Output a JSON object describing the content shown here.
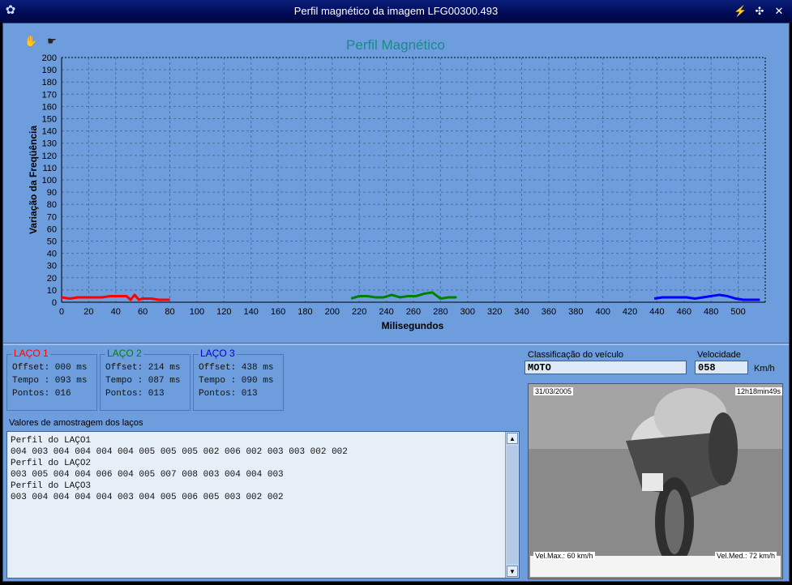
{
  "window": {
    "title": "Perfil magnético da imagem LFG00300.493"
  },
  "chart_data": {
    "type": "line",
    "title": "Perfil Magnético",
    "xlabel": "Milisegundos",
    "ylabel": "Variação da Freqüência",
    "xlim": [
      0,
      520
    ],
    "ylim": [
      0,
      200
    ],
    "x_ticks": [
      0,
      20,
      40,
      60,
      80,
      100,
      120,
      140,
      160,
      180,
      200,
      220,
      240,
      260,
      280,
      300,
      320,
      340,
      360,
      380,
      400,
      420,
      440,
      460,
      480,
      500
    ],
    "y_ticks": [
      0,
      10,
      20,
      30,
      40,
      50,
      60,
      70,
      80,
      90,
      100,
      110,
      120,
      130,
      140,
      150,
      160,
      170,
      180,
      190,
      200
    ],
    "grid": true,
    "series": [
      {
        "name": "LAÇO 1",
        "color": "#ff0000",
        "x": [
          0,
          6,
          12,
          18,
          24,
          30,
          36,
          42,
          48,
          51,
          54,
          57,
          60,
          66,
          72,
          78,
          80
        ],
        "y": [
          4,
          3,
          4,
          4,
          4,
          4,
          5,
          5,
          5,
          2,
          6,
          2,
          3,
          3,
          2,
          2,
          2
        ]
      },
      {
        "name": "LAÇO 2",
        "color": "#008000",
        "x": [
          214,
          220,
          226,
          232,
          238,
          244,
          250,
          256,
          262,
          268,
          274,
          280,
          286,
          292
        ],
        "y": [
          3,
          5,
          5,
          4,
          4,
          6,
          4,
          5,
          5,
          7,
          8,
          3,
          4,
          4
        ]
      },
      {
        "name": "LAÇO 3",
        "color": "#0000ff",
        "x": [
          438,
          444,
          450,
          456,
          462,
          468,
          474,
          480,
          486,
          492,
          498,
          504,
          510,
          516
        ],
        "y": [
          3,
          4,
          4,
          4,
          4,
          3,
          4,
          5,
          6,
          5,
          3,
          2,
          2,
          2
        ]
      }
    ]
  },
  "loops": [
    {
      "title": "LAÇO 1",
      "color": "#ff0000",
      "offset": "Offset: 000 ms",
      "tempo": "Tempo : 093 ms",
      "pontos": "Pontos: 016"
    },
    {
      "title": "LAÇO 2",
      "color": "#008000",
      "offset": "Offset: 214 ms",
      "tempo": "Tempo : 087 ms",
      "pontos": "Pontos: 013"
    },
    {
      "title": "LAÇO 3",
      "color": "#0000cc",
      "offset": "Offset: 438 ms",
      "tempo": "Tempo : 090 ms",
      "pontos": "Pontos: 013"
    }
  ],
  "samples": {
    "label": "Valores de amostragem dos laços",
    "lines": [
      "Perfil do LAÇO1",
      "004 003 004 004 004 004 005 005 005 002 006 002 003 003 002 002",
      "Perfil do LAÇO2",
      "003 005 004 004 006 004 005 007 008 003 004 004 003",
      "Perfil do LAÇO3",
      "003 004 004 004 004 003 004 005 006 005 003 002 002"
    ]
  },
  "classification": {
    "label": "Classificação do veículo",
    "value": "MOTO"
  },
  "speed": {
    "label": "Velocidade",
    "value": "058",
    "unit": "Km/h"
  },
  "photo": {
    "date": "31/03/2005",
    "time": "12h18min49s",
    "velmax": "Vel.Max.: 60  km/h",
    "velmed": "Vel.Med.: 72  km/h"
  }
}
